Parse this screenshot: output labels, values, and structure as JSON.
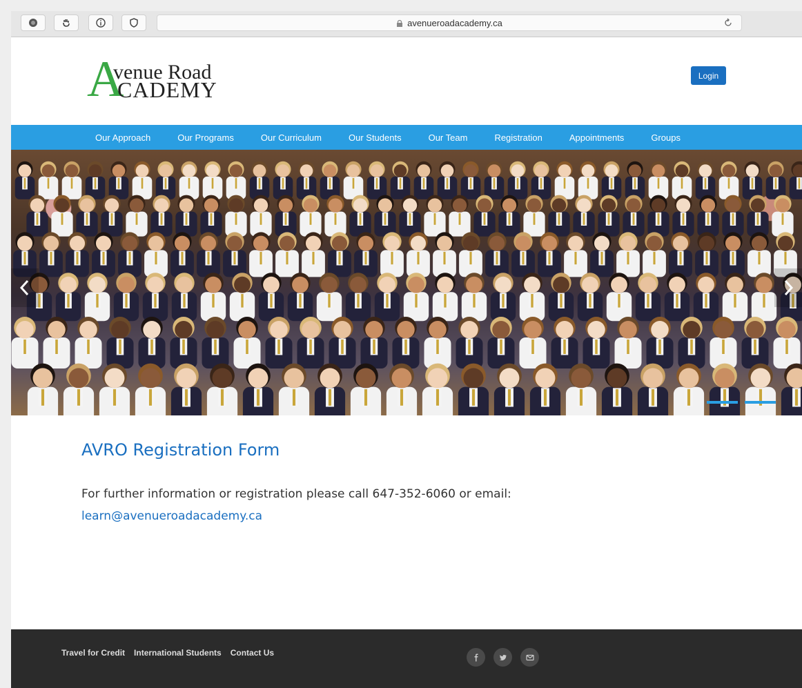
{
  "browser": {
    "url": "avenueroadacademy.ca",
    "buttons": [
      "record-icon",
      "hand-icon",
      "info-icon",
      "shield-icon"
    ],
    "reload_icon": "reload-icon"
  },
  "header": {
    "logo": {
      "letter_a": "A",
      "line1": "venue Road",
      "line2": "CADEMY"
    },
    "login_label": "Login",
    "login_color": "#1a6fc0"
  },
  "nav": {
    "color": "#2a9ee2",
    "items": [
      "Our Approach",
      "Our Programs",
      "Our Curriculum",
      "Our Students",
      "Our Team",
      "Registration",
      "Appointments",
      "Groups"
    ]
  },
  "hero": {
    "prev_icon": "chevron-left-icon",
    "next_icon": "chevron-right-icon",
    "slide_count": 2
  },
  "main": {
    "title": "AVRO Registration Form",
    "info": "For further information or registration please call 647-352-6060 or email:",
    "email": "learn@avenueroadacademy.ca"
  },
  "footer": {
    "links": [
      "Travel for Credit",
      "International Students",
      "Contact Us"
    ],
    "social": [
      "facebook-icon",
      "twitter-icon",
      "email-icon"
    ]
  }
}
